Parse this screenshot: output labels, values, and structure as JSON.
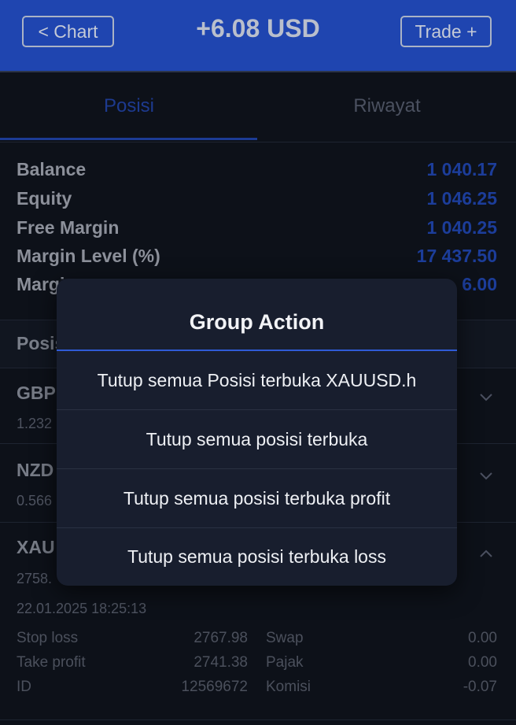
{
  "header": {
    "back_label": "< Chart",
    "title": "+6.08 USD",
    "trade_label": "Trade +"
  },
  "tabs": [
    {
      "label": "Posisi"
    },
    {
      "label": "Riwayat"
    }
  ],
  "summary": {
    "balance": {
      "label": "Balance",
      "value": "1 040.17"
    },
    "equity": {
      "label": "Equity",
      "value": "1 046.25"
    },
    "free_margin": {
      "label": "Free Margin",
      "value": "1 040.25"
    },
    "margin_level": {
      "label": "Margin Level (%)",
      "value": "17 437.50"
    },
    "margin": {
      "label": "Margi",
      "value": "6.00"
    }
  },
  "positions_header": "Posis",
  "positions": [
    {
      "symbol": "GBPU",
      "sub": "1.232"
    },
    {
      "symbol": "NZD",
      "sub": "0.566"
    },
    {
      "symbol": "XAU",
      "sub": "2758.",
      "time": "22.01.2025 18:25:13"
    }
  ],
  "xau_details": {
    "stop_loss": {
      "label": "Stop loss",
      "value": "2767.98"
    },
    "take_profit": {
      "label": "Take profit",
      "value": "2741.38"
    },
    "id": {
      "label": "ID",
      "value": "12569672"
    },
    "swap": {
      "label": "Swap",
      "value": "0.00"
    },
    "pajak": {
      "label": "Pajak",
      "value": "0.00"
    },
    "komisi": {
      "label": "Komisi",
      "value": "-0.07"
    }
  },
  "modal": {
    "title": "Group Action",
    "options": [
      "Tutup semua Posisi terbuka XAUUSD.h",
      "Tutup semua posisi terbuka",
      "Tutup semua posisi terbuka profit",
      "Tutup semua posisi terbuka loss"
    ]
  }
}
